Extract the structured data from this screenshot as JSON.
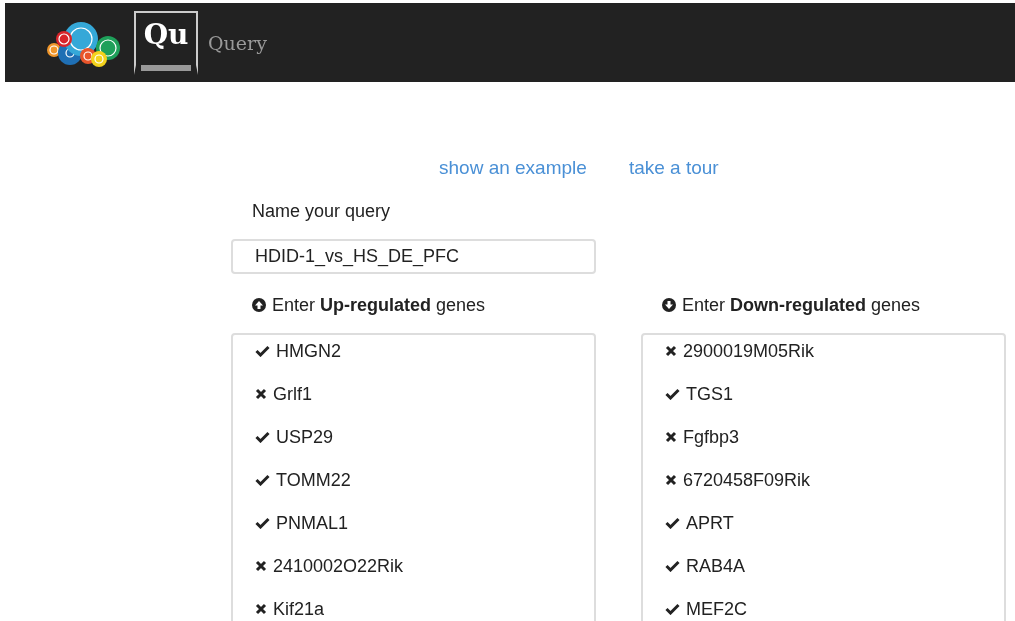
{
  "header": {
    "logo_text": "Qu",
    "title": "Query"
  },
  "links": [
    "show an example",
    "take a tour"
  ],
  "query_name": {
    "label": "Name your query",
    "value": "HDID-1_vs_HS_DE_PFC"
  },
  "gene_lists": [
    {
      "kind": "up",
      "heading": "Enter **Up-regulated** genes",
      "genes": [
        {
          "name": "HMGN2",
          "valid": true
        },
        {
          "name": "Grlf1",
          "valid": false
        },
        {
          "name": "USP29",
          "valid": true
        },
        {
          "name": "TOMM22",
          "valid": true
        },
        {
          "name": "PNMAL1",
          "valid": true
        },
        {
          "name": "2410002O22Rik",
          "valid": false
        },
        {
          "name": "Kif21a",
          "valid": false
        }
      ]
    },
    {
      "kind": "down",
      "heading": "Enter **Down-regulated** genes",
      "genes": [
        {
          "name": "2900019M05Rik",
          "valid": false
        },
        {
          "name": "TGS1",
          "valid": true
        },
        {
          "name": "Fgfbp3",
          "valid": false
        },
        {
          "name": "6720458F09Rik",
          "valid": false
        },
        {
          "name": "APRT",
          "valid": true
        },
        {
          "name": "RAB4A",
          "valid": true
        },
        {
          "name": "MEF2C",
          "valid": true
        }
      ]
    }
  ]
}
